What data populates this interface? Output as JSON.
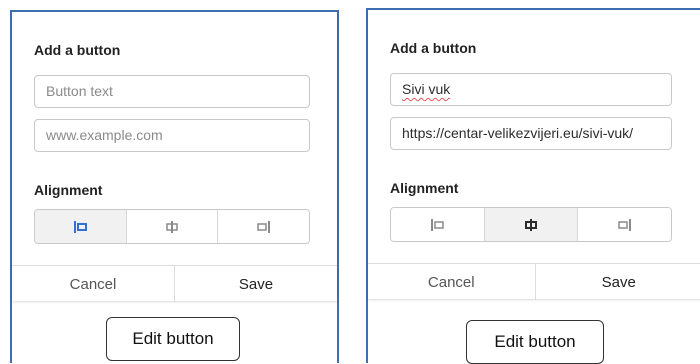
{
  "panels": [
    {
      "title": "Add a button",
      "button_text": "Button text",
      "url": "www.example.com",
      "alignment_label": "Alignment",
      "alignment_options": [
        "align-left-icon",
        "align-center-icon",
        "align-right-icon"
      ],
      "selected_alignment": "left",
      "cancel_label": "Cancel",
      "save_label": "Save",
      "edit_label": "Edit button"
    },
    {
      "title": "Add a button",
      "button_text": "Sivi vuk",
      "url": "https://centar-velikezvijeri.eu/sivi-vuk/",
      "alignment_label": "Alignment",
      "alignment_options": [
        "align-left-icon",
        "align-center-icon",
        "align-right-icon"
      ],
      "selected_alignment": "center",
      "cancel_label": "Cancel",
      "save_label": "Save",
      "edit_label": "Edit button"
    }
  ],
  "colors": {
    "frame_border": "#3f6fb1",
    "accent_icon": "#2f6fd6",
    "muted_icon": "#8a8a8a"
  }
}
